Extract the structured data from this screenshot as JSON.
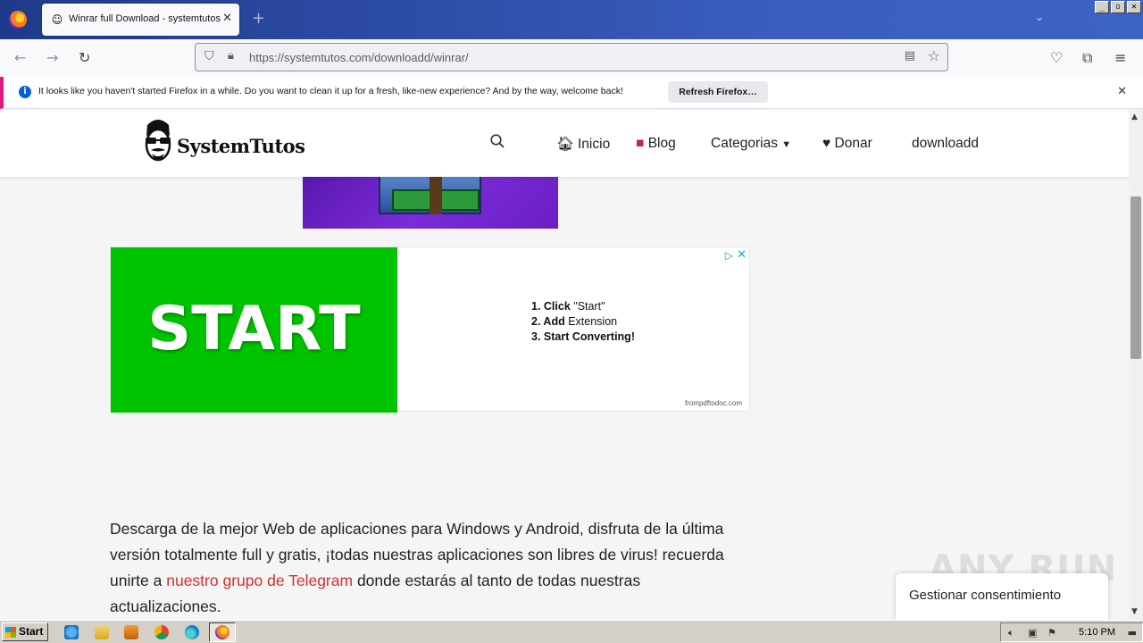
{
  "browser": {
    "tab_title": "Winrar full Download - systemtutos",
    "url_host": "https://systemtutos.com",
    "url_path": "/downloadd/winrar/",
    "notification": {
      "message": "It looks like you haven't started Firefox in a while. Do you want to clean it up for a fresh, like-new experience? And by the way, welcome back!",
      "button": "Refresh Firefox…"
    }
  },
  "site": {
    "logo_text": "SystemTutos",
    "menu": [
      {
        "icon": "house-icon",
        "label": "Inicio"
      },
      {
        "icon": "book-icon",
        "label": "Blog"
      },
      {
        "label": "Categorias"
      },
      {
        "icon": "heart-icon",
        "label": "Donar"
      },
      {
        "label": "downloadd"
      }
    ]
  },
  "ad": {
    "headline": "START",
    "step1_bold": "1. Click",
    "step1_rest": " \"Start\"",
    "step2_bold": "2. Add",
    "step2_rest": "  Extension",
    "step3_bold": "3. Start Converting!",
    "domain": "frompdftodoc.com"
  },
  "content": {
    "intro_before": "Descarga de la mejor Web de aplicaciones para Windows y Android, disfruta de la última versión totalmente full y gratis, ¡todas nuestras aplicaciones son libres de virus! recuerda unirte a ",
    "link_text": "nuestro grupo de Telegram",
    "intro_after": " donde estarás al tanto de todas nuestras actualizaciones."
  },
  "consent_button": "Gestionar consentimiento",
  "watermark": "ANY RUN",
  "taskbar": {
    "start_label": "Start",
    "time": "5:10 PM"
  }
}
